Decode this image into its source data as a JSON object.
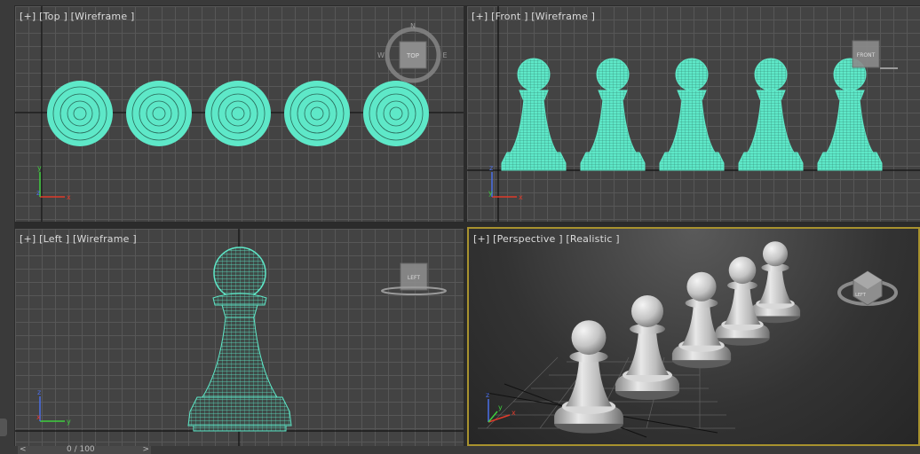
{
  "viewports": {
    "top": {
      "label": "[+] [Top ] [Wireframe ]",
      "cube_label": "TOP",
      "compass": {
        "n": "N",
        "w": "W",
        "e": "E"
      }
    },
    "front": {
      "label": "[+] [Front ] [Wireframe ]",
      "cube_label": "FRONT"
    },
    "left": {
      "label": "[+] [Left ] [Wireframe ]",
      "cube_label": "LEFT"
    },
    "perspective": {
      "label": "[+] [Perspective ] [Realistic ]",
      "cube_label": "LEFT"
    }
  },
  "axes": {
    "x": "x",
    "y": "y",
    "z": "z"
  },
  "timeslider": {
    "prev": "<",
    "next": ">",
    "frame": "0 / 100"
  },
  "colors": {
    "wire": "#5ee8c8",
    "active_border": "#a8922e",
    "viewport_bg": "#434343",
    "x_axis": "#e03a2a",
    "y_axis": "#3ed03e",
    "z_axis": "#4b6fe8"
  },
  "icons": [
    "viewcube-icon",
    "axis-tripod-icon",
    "pawn-wireframe-icon",
    "pawn-shaded-icon"
  ]
}
